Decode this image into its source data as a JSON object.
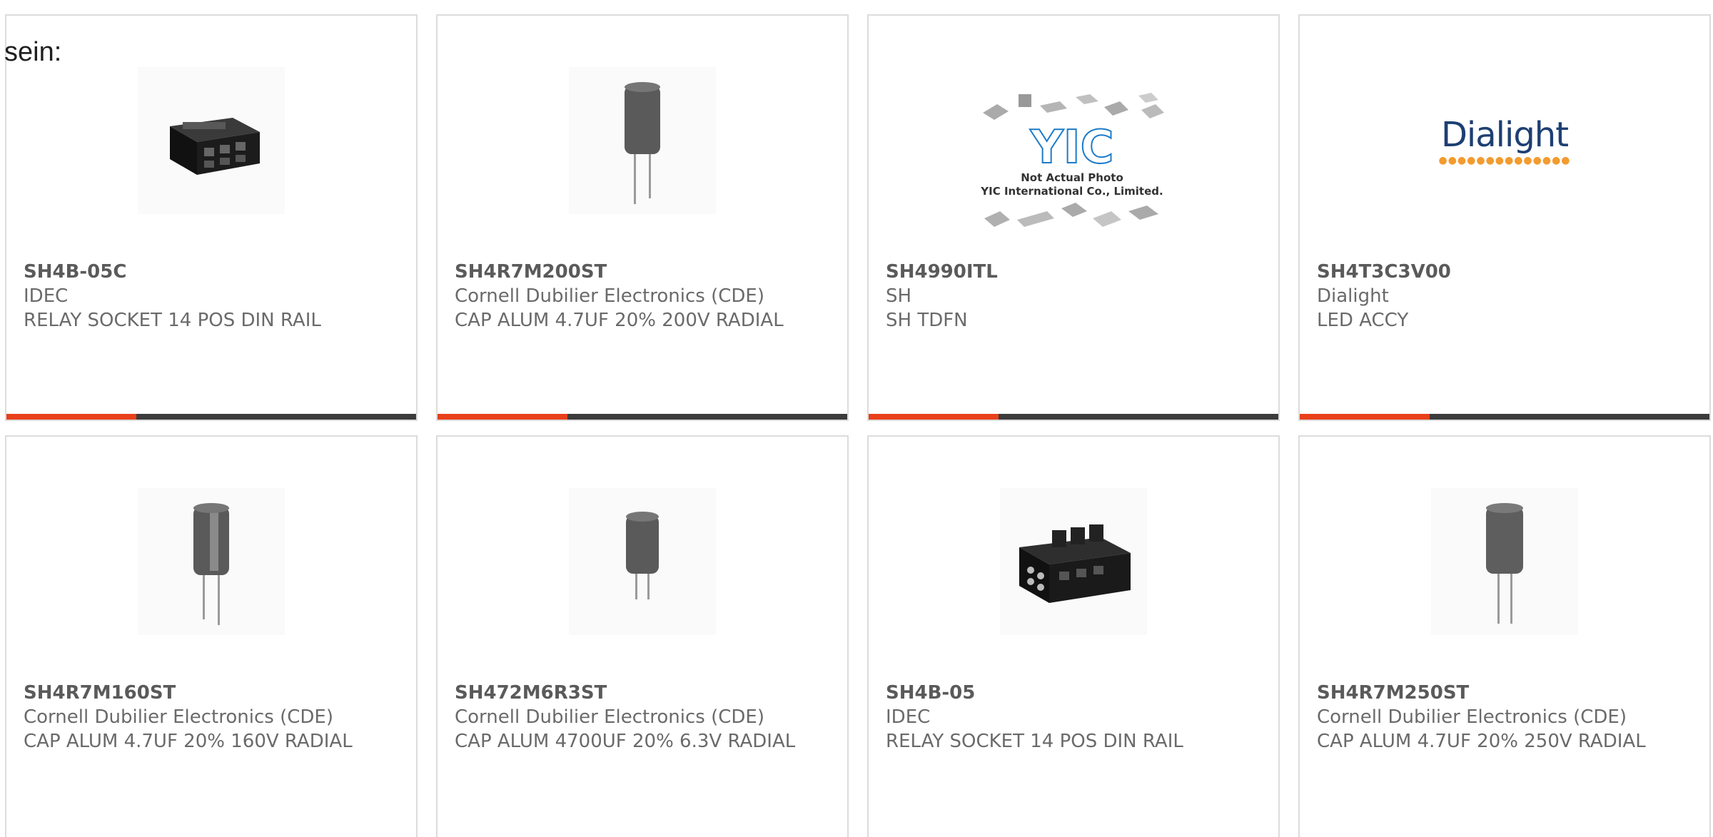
{
  "lead_text": "sein:",
  "colors": {
    "accent": "#e8401a",
    "bar": "#3c3c3c",
    "card_border": "#dcdcdc"
  },
  "products": [
    {
      "part_number": "SH4B-05C",
      "manufacturer": "IDEC",
      "description": "RELAY SOCKET 14 POS DIN RAIL",
      "image": "relay-socket-icon"
    },
    {
      "part_number": "SH4R7M200ST",
      "manufacturer": "Cornell Dubilier Electronics (CDE)",
      "description": "CAP ALUM 4.7UF 20% 200V RADIAL",
      "image": "capacitor-icon"
    },
    {
      "part_number": "SH4990ITL",
      "manufacturer": "SH",
      "description": "SH TDFN",
      "image": "yic-placeholder-icon",
      "image_caption_line1": "Not Actual Photo",
      "image_caption_line2": "YIC International Co., Limited.",
      "image_logo": "YIC"
    },
    {
      "part_number": "SH4T3C3V00",
      "manufacturer": "Dialight",
      "description": "LED ACCY",
      "image": "dialight-logo",
      "image_logo": "Dialight"
    },
    {
      "part_number": "SH4R7M160ST",
      "manufacturer": "Cornell Dubilier Electronics (CDE)",
      "description": "CAP ALUM 4.7UF 20% 160V RADIAL",
      "image": "capacitor-icon"
    },
    {
      "part_number": "SH472M6R3ST",
      "manufacturer": "Cornell Dubilier Electronics (CDE)",
      "description": "CAP ALUM 4700UF 20% 6.3V RADIAL",
      "image": "capacitor-icon"
    },
    {
      "part_number": "SH4B-05",
      "manufacturer": "IDEC",
      "description": "RELAY SOCKET 14 POS DIN RAIL",
      "image": "relay-socket-icon"
    },
    {
      "part_number": "SH4R7M250ST",
      "manufacturer": "Cornell Dubilier Electronics (CDE)",
      "description": "CAP ALUM 4.7UF 20% 250V RADIAL",
      "image": "capacitor-icon"
    }
  ]
}
